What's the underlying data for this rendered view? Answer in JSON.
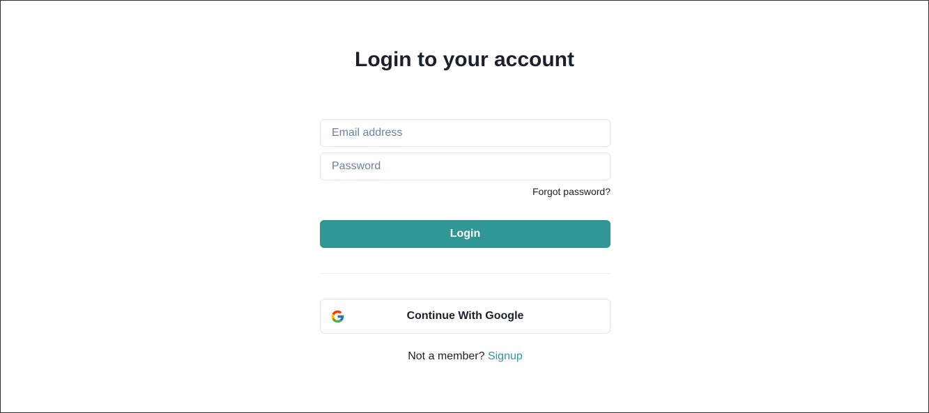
{
  "page": {
    "title": "Login to your account"
  },
  "form": {
    "email": {
      "placeholder": "Email address",
      "value": ""
    },
    "password": {
      "placeholder": "Password",
      "value": ""
    },
    "forgot_password_label": "Forgot password?",
    "login_label": "Login"
  },
  "social": {
    "google_label": "Continue With Google",
    "google_icon": "google-icon"
  },
  "footer": {
    "prompt": "Not a member?",
    "signup_label": "Signup"
  },
  "colors": {
    "accent": "#319795",
    "text": "#1a202c",
    "placeholder": "#718096",
    "border": "#e2e8f0"
  }
}
